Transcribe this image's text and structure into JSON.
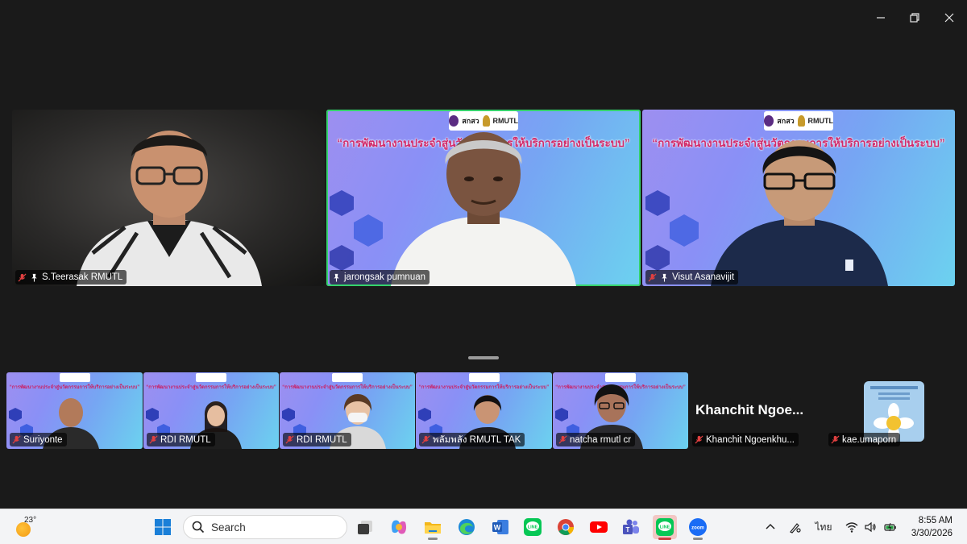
{
  "window": {
    "controls": [
      "minimize",
      "restore",
      "close"
    ]
  },
  "main_tiles": [
    {
      "name": "S.Teerasak RMUTL",
      "muted": true,
      "pinned": true,
      "active_speaker": false,
      "has_slide_bg": false
    },
    {
      "name": "jarongsak pumnuan",
      "muted": false,
      "pinned": true,
      "active_speaker": true,
      "has_slide_bg": true
    },
    {
      "name": "Visut Asanavijit",
      "muted": true,
      "pinned": true,
      "active_speaker": false,
      "has_slide_bg": true
    }
  ],
  "slide": {
    "title": "“การพัฒนางานประจำสู่นวัตกรรมการให้บริการอย่างเป็นระบบ”",
    "logo_text": "RMUTL",
    "logo_sub": "สกสว"
  },
  "gallery_tiles": [
    {
      "name": "Suriyonte",
      "muted": true
    },
    {
      "name": "RDI RMUTL",
      "muted": true
    },
    {
      "name": "RDI RMUTL",
      "muted": true
    },
    {
      "name": "พลัมพลัง RMUTL TAK",
      "muted": true
    },
    {
      "name": "natcha rmutl cr",
      "muted": true
    }
  ],
  "no_video_tiles": [
    {
      "display": "Khanchit  Ngoe...",
      "name": "Khanchit Ngoenkhu...",
      "muted": true
    },
    {
      "display": "",
      "name": "kae.umaporn",
      "muted": true
    }
  ],
  "taskbar": {
    "weather_temp": "23°",
    "search_placeholder": "Search",
    "language": "ไทย",
    "time": "8:55 AM",
    "date": "3/30/2026"
  }
}
